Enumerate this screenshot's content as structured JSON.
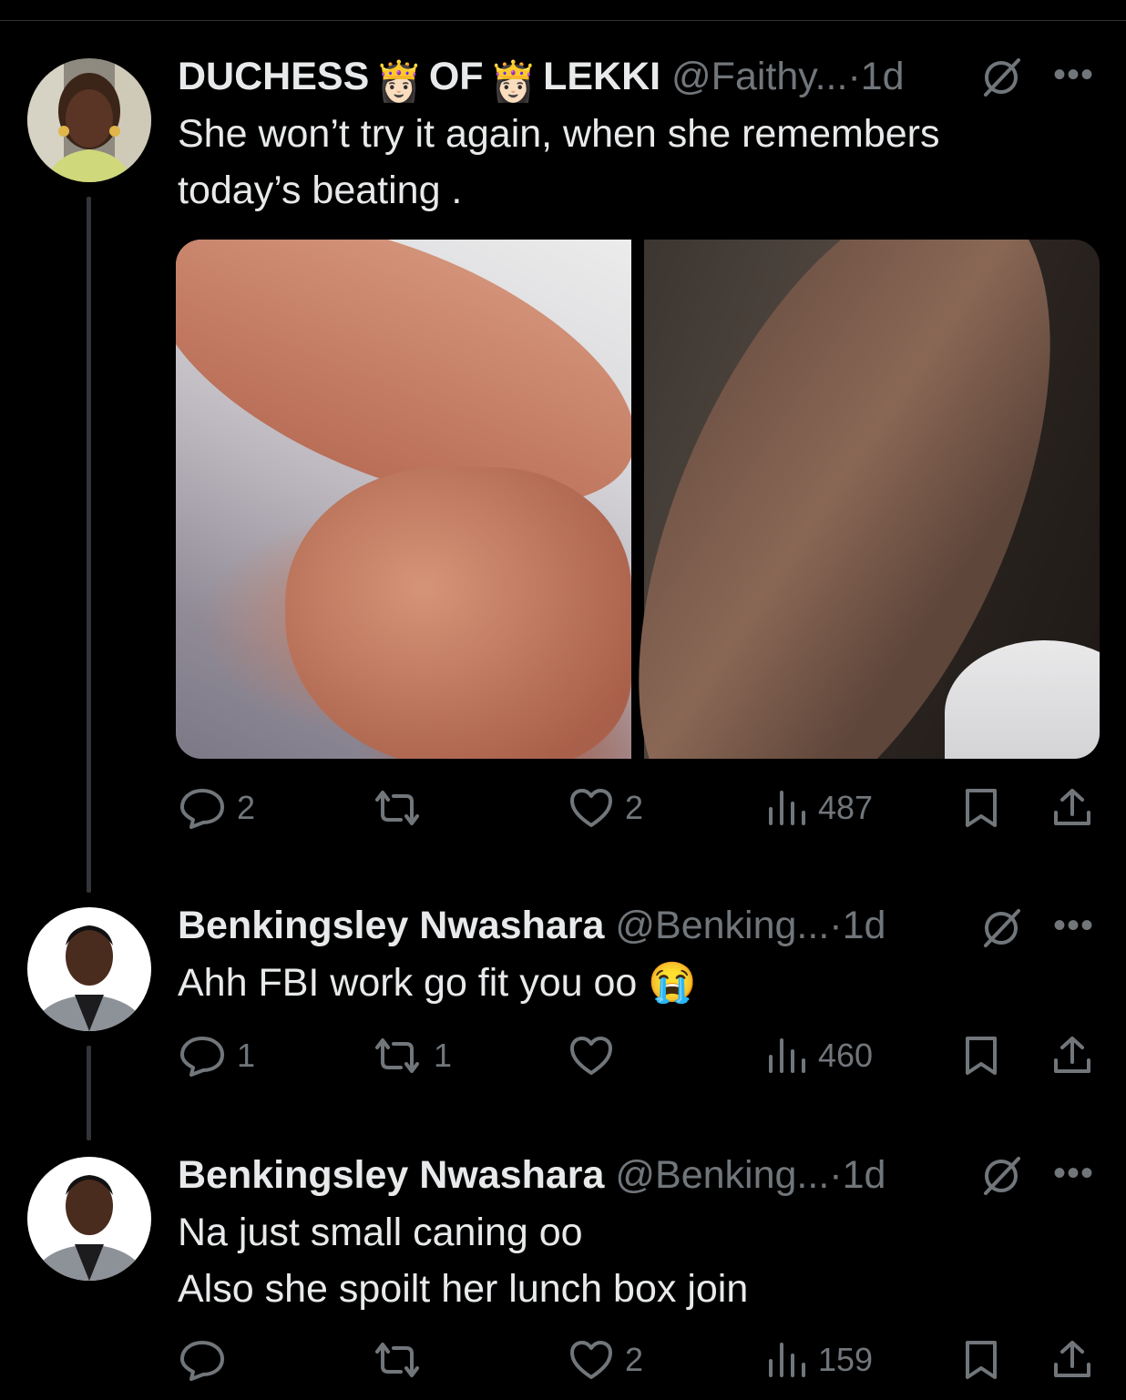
{
  "tweets": [
    {
      "name_parts": [
        "DUCHESS",
        "OF",
        "LEKKI"
      ],
      "crown_emoji": "👸🏻",
      "handle": "@Faithy...",
      "time": "1d",
      "text_lines": [
        "She won’t try it again, when she remembers",
        "today’s beating ."
      ],
      "stats": {
        "replies": "2",
        "reposts": "",
        "likes": "2",
        "views": "487"
      }
    },
    {
      "name": "Benkingsley Nwashara",
      "handle": "@Benking...",
      "time": "1d",
      "text_lines": [
        "Ahh FBI work go fit you oo"
      ],
      "text_emoji": "😭",
      "stats": {
        "replies": "1",
        "reposts": "1",
        "likes": "",
        "views": "460"
      }
    },
    {
      "name": "Benkingsley Nwashara",
      "handle": "@Benking...",
      "time": "1d",
      "text_lines": [
        "Na just small caning oo",
        "Also she spoilt her lunch box join"
      ],
      "stats": {
        "replies": "",
        "reposts": "",
        "likes": "2",
        "views": "159"
      }
    }
  ],
  "icons": {
    "reply": "reply-icon",
    "repost": "repost-icon",
    "like": "heart-icon",
    "views": "views-icon",
    "bookmark": "bookmark-icon",
    "share": "share-icon",
    "mute": "mute-icon",
    "more": "more-icon"
  },
  "colors": {
    "background": "#000000",
    "text": "#e7e9ea",
    "secondary": "#71767b",
    "divider": "#2f3336"
  }
}
